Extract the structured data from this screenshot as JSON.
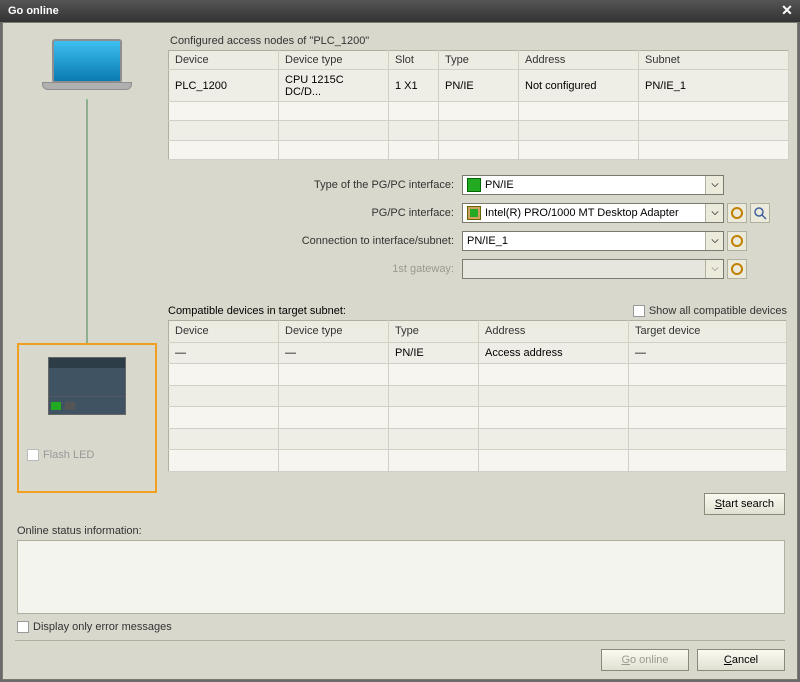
{
  "titlebar": {
    "title": "Go online"
  },
  "configured": {
    "heading": "Configured access nodes of \"PLC_1200\"",
    "columns": [
      "Device",
      "Device type",
      "Slot",
      "Type",
      "Address",
      "Subnet"
    ],
    "rows": [
      {
        "device": "PLC_1200",
        "dtype": "CPU 1215C DC/D...",
        "slot": "1 X1",
        "type": "PN/IE",
        "addr": "Not configured",
        "subnet": "PN/IE_1"
      }
    ]
  },
  "iface": {
    "type_label": "Type of the PG/PC interface:",
    "type_value": "PN/IE",
    "pgpc_label": "PG/PC interface:",
    "pgpc_value": "Intel(R) PRO/1000 MT Desktop Adapter",
    "conn_label": "Connection to interface/subnet:",
    "conn_value": "PN/IE_1",
    "gw_label": "1st gateway:",
    "gw_value": ""
  },
  "compat": {
    "heading": "Compatible devices in target subnet:",
    "show_all": "Show all compatible devices",
    "columns": [
      "Device",
      "Device type",
      "Type",
      "Address",
      "Target device"
    ],
    "rows": [
      {
        "device": "—",
        "dtype": "—",
        "type": "PN/IE",
        "addr": "Access address",
        "target": "—"
      }
    ]
  },
  "flash_led": "Flash LED",
  "start_search": "Start search",
  "status_label": "Online status information:",
  "err_only": "Display only error messages",
  "buttons": {
    "go_online": "Go online",
    "cancel": "Cancel"
  },
  "icons": {
    "globe": "globe-icon",
    "magnify": "magnify-icon",
    "link": "link-icon"
  }
}
